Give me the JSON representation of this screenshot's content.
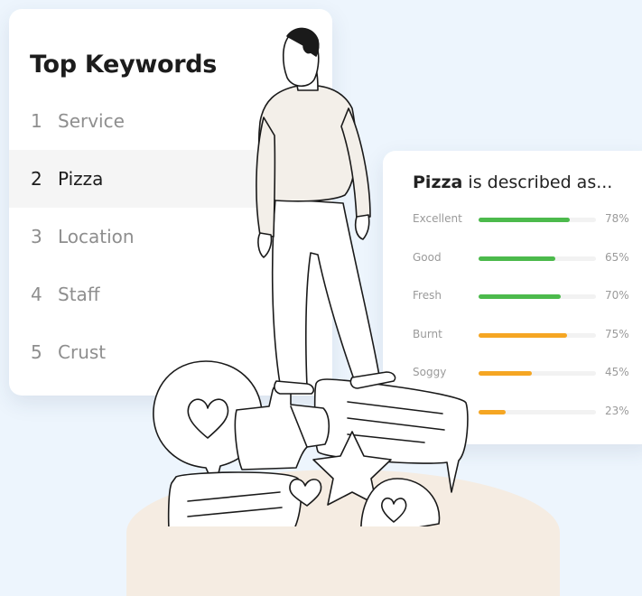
{
  "keywords_card": {
    "title": "Top Keywords",
    "items": [
      {
        "rank": "1",
        "label": "Service",
        "active": false
      },
      {
        "rank": "2",
        "label": "Pizza",
        "active": true
      },
      {
        "rank": "3",
        "label": "Location",
        "active": false
      },
      {
        "rank": "4",
        "label": "Staff",
        "active": false
      },
      {
        "rank": "5",
        "label": "Crust",
        "active": false
      }
    ]
  },
  "pizza_card": {
    "subject": "Pizza",
    "title_rest": " is described as...",
    "rows": [
      {
        "label": "Excellent",
        "value": 78,
        "pct": "78%",
        "color": "#4cba4c"
      },
      {
        "label": "Good",
        "value": 65,
        "pct": "65%",
        "color": "#4cba4c"
      },
      {
        "label": "Fresh",
        "value": 70,
        "pct": "70%",
        "color": "#4cba4c"
      },
      {
        "label": "Burnt",
        "value": 75,
        "pct": "75%",
        "color": "#f5a623"
      },
      {
        "label": "Soggy",
        "value": 45,
        "pct": "45%",
        "color": "#f5a623"
      },
      {
        "label": "",
        "value": 23,
        "pct": "23%",
        "color": "#f5a623"
      }
    ]
  },
  "colors": {
    "background": "#edf5fd",
    "positive": "#4cba4c",
    "negative": "#f5a623",
    "text_dark": "#1c1c1c",
    "text_muted": "#8e8e8e"
  }
}
